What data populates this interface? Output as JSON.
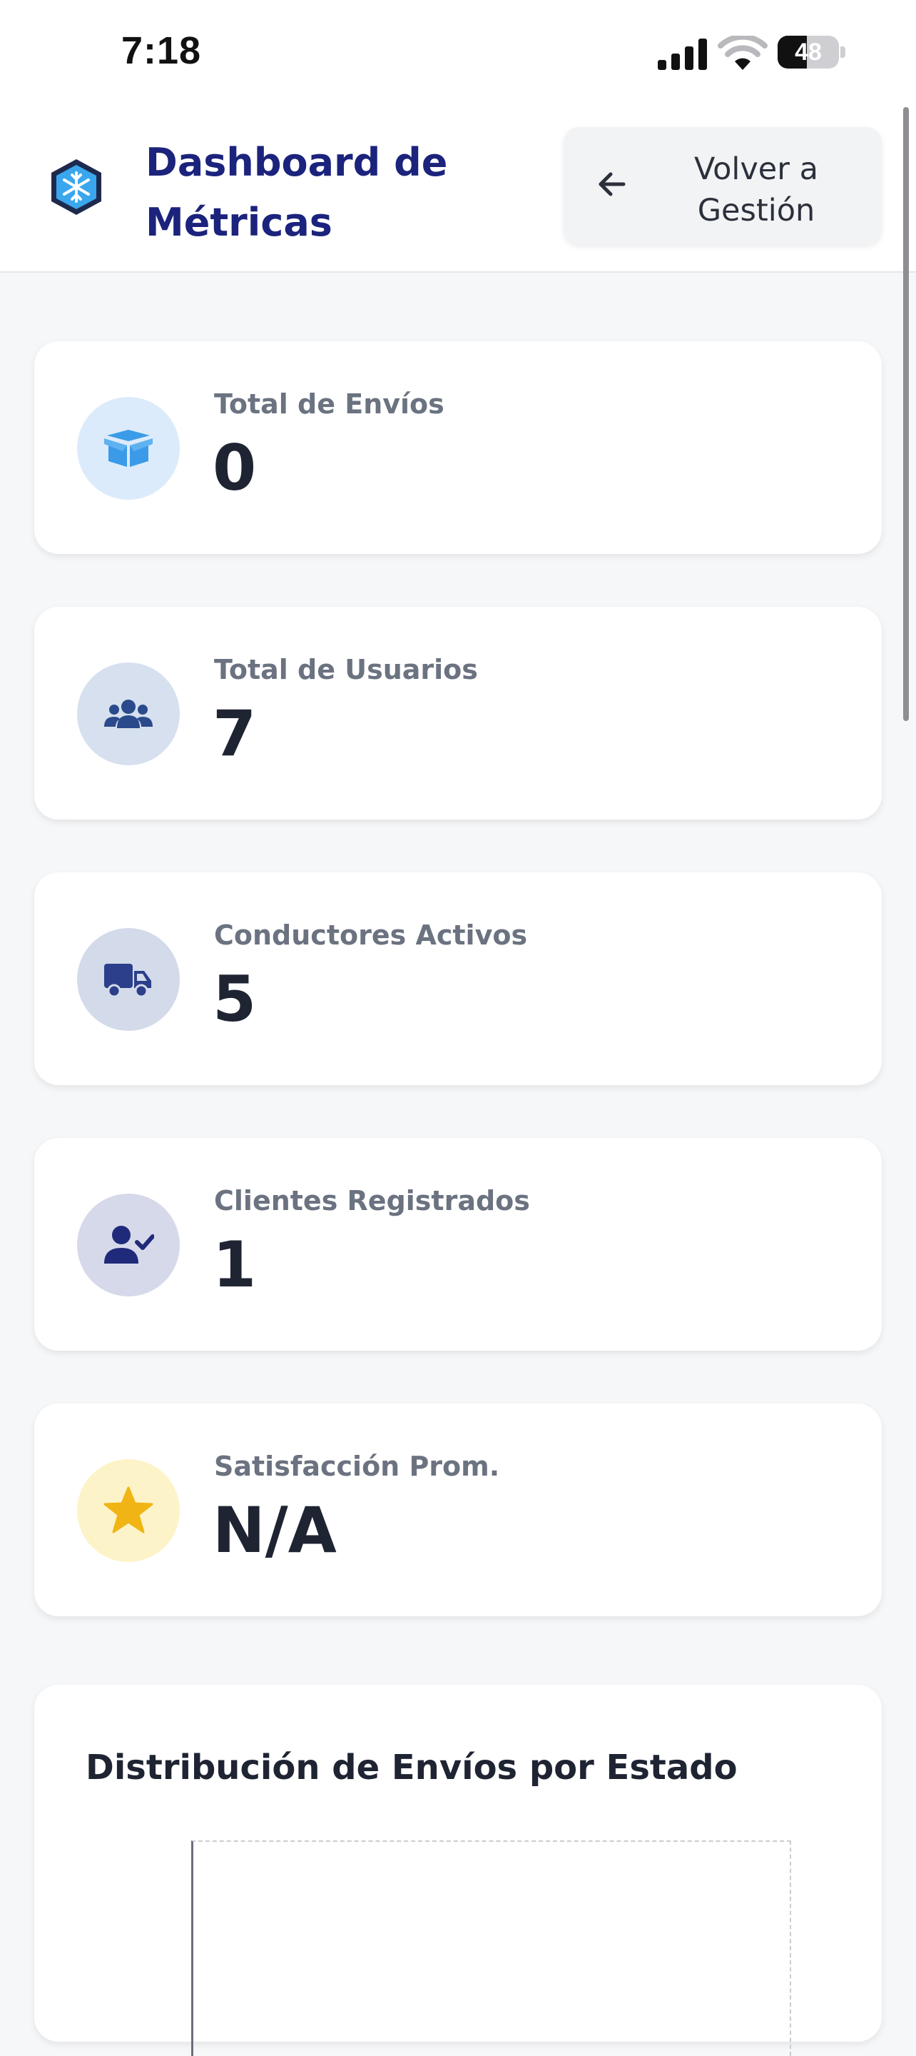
{
  "status_bar": {
    "time": "7:18",
    "battery": "48",
    "battery_level": 0.48
  },
  "header": {
    "title": "Dashboard de Métricas",
    "back_button": "Volver a Gestión"
  },
  "metrics": [
    {
      "label": "Total de Envíos",
      "value": "0",
      "icon": "box-open-icon",
      "bg": "#dcebfb",
      "fg": "#3b9be8"
    },
    {
      "label": "Total de Usuarios",
      "value": "7",
      "icon": "users-icon",
      "bg": "#d6e0ee",
      "fg": "#2a4a8c"
    },
    {
      "label": "Conductores Activos",
      "value": "5",
      "icon": "truck-icon",
      "bg": "#d3dae9",
      "fg": "#2b3f8a"
    },
    {
      "label": "Clientes Registrados",
      "value": "1",
      "icon": "user-check-icon",
      "bg": "#d6d9ea",
      "fg": "#1f2a7a"
    },
    {
      "label": "Satisfacción Prom.",
      "value": "N/A",
      "icon": "star-icon",
      "bg": "#fdf3c8",
      "fg": "#f0b414"
    }
  ],
  "chart": {
    "title": "Distribución de Envíos por Estado"
  },
  "colors": {
    "brand": "#1b237c",
    "background": "#f6f7f9"
  }
}
